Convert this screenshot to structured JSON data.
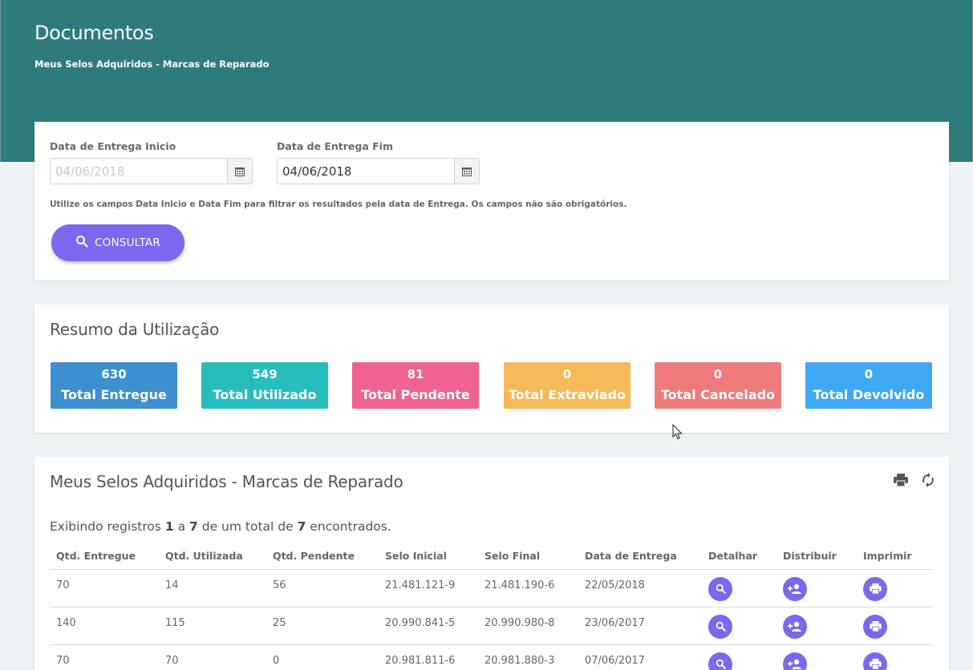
{
  "header": {
    "title": "Documentos",
    "subtitle": "Meus Selos Adquiridos - Marcas de Reparado"
  },
  "filter": {
    "start_label": "Data de Entrega Inicio",
    "start_placeholder": "04/06/2018",
    "start_value": "",
    "end_label": "Data de Entrega Fim",
    "end_value": "04/06/2018",
    "hint": "Utilize os campos Data Inicio e Data Fim para filtrar os resultados pela data de Entrega. Os campos não são obrigatórios.",
    "consult_label": "CONSULTAR"
  },
  "summary": {
    "title": "Resumo da Utilização",
    "stats": [
      {
        "value": "630",
        "label": "Total Entregue",
        "color": "#3d8fcf"
      },
      {
        "value": "549",
        "label": "Total Utilizado",
        "color": "#28bdbd"
      },
      {
        "value": "81",
        "label": "Total Pendente",
        "color": "#f06292"
      },
      {
        "value": "0",
        "label": "Total Extraviado",
        "color": "#f5b957"
      },
      {
        "value": "0",
        "label": "Total Cancelado",
        "color": "#ef7a7a"
      },
      {
        "value": "0",
        "label": "Total Devolvido",
        "color": "#3fa9f5"
      }
    ]
  },
  "table_section": {
    "title": "Meus Selos Adquiridos - Marcas de Reparado",
    "records_prefix": "Exibindo registros ",
    "records_from": "1",
    "records_mid1": " a ",
    "records_to": "7",
    "records_mid2": " de um total de ",
    "records_total": "7",
    "records_suffix": " encontrados.",
    "columns": [
      "Qtd. Entregue",
      "Qtd. Utilizada",
      "Qtd. Pendente",
      "Selo Inicial",
      "Selo Final",
      "Data de Entrega",
      "Detalhar",
      "Distribuir",
      "Imprimir"
    ],
    "rows": [
      {
        "entregue": "70",
        "utilizada": "14",
        "pendente": "56",
        "inicial": "21.481.121-9",
        "final": "21.481.190-6",
        "data": "22/05/2018"
      },
      {
        "entregue": "140",
        "utilizada": "115",
        "pendente": "25",
        "inicial": "20.990.841-5",
        "final": "20.990.980-8",
        "data": "23/06/2017"
      },
      {
        "entregue": "70",
        "utilizada": "70",
        "pendente": "0",
        "inicial": "20.981.811-6",
        "final": "20.981.880-3",
        "data": "07/06/2017"
      }
    ]
  },
  "icons": {
    "calendar": "calendar-icon",
    "search": "search-icon",
    "print": "print-icon",
    "refresh": "refresh-icon",
    "add_user": "add-user-icon"
  },
  "colors": {
    "header": "#2e7b7d",
    "accent": "#7b68ee"
  }
}
